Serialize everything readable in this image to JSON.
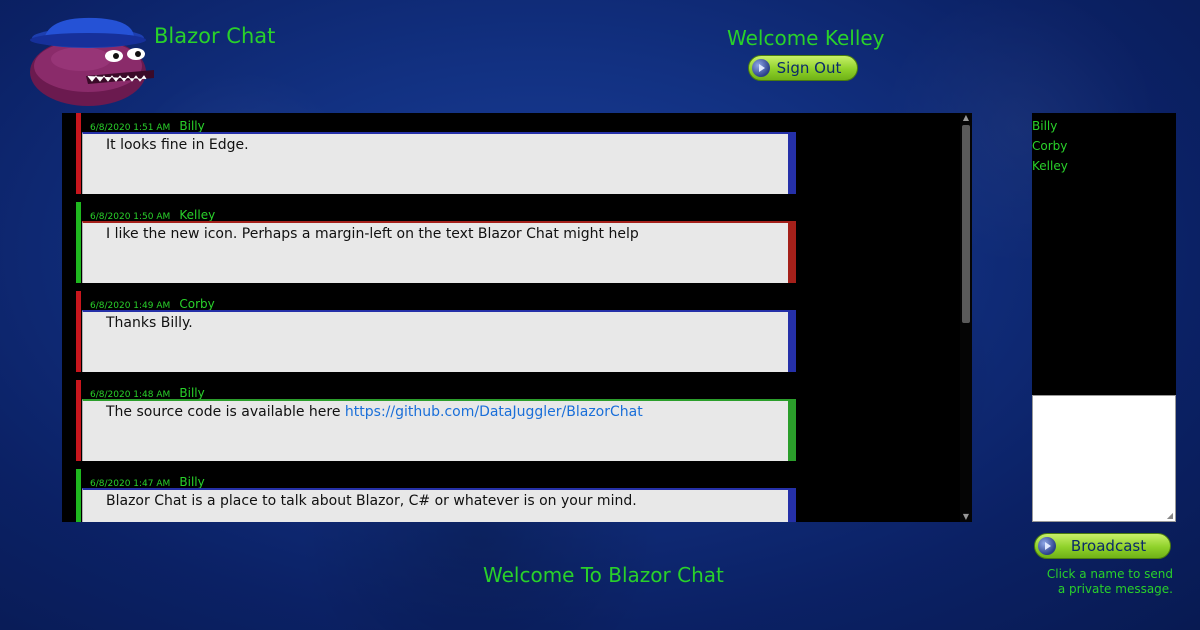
{
  "header": {
    "app_title": "Blazor Chat",
    "welcome_text": "Welcome Kelley",
    "sign_out_label": "Sign Out"
  },
  "colors": {
    "accent_green": "#29d12a",
    "bar_red": "#c8161d",
    "bar_green": "#1fb81f",
    "edge_blue": "#2530a8",
    "edge_red": "#a4201a",
    "edge_green": "#2b9e2b"
  },
  "messages": [
    {
      "time": "6/8/2020 1:51 AM",
      "sender": "Billy",
      "text": "It looks fine in Edge.",
      "link": "",
      "bar_color": "#c8161d",
      "edge_color": "#2530a8"
    },
    {
      "time": "6/8/2020 1:50 AM",
      "sender": "Kelley",
      "text": "I like the new icon. Perhaps a margin-left on the text Blazor Chat might help",
      "link": "",
      "bar_color": "#1fb81f",
      "edge_color": "#a4201a"
    },
    {
      "time": "6/8/2020 1:49 AM",
      "sender": "Corby",
      "text": "Thanks Billy.",
      "link": "",
      "bar_color": "#c8161d",
      "edge_color": "#2530a8"
    },
    {
      "time": "6/8/2020 1:48 AM",
      "sender": "Billy",
      "text": "The source code is available here ",
      "link": "https://github.com/DataJuggler/BlazorChat",
      "bar_color": "#c8161d",
      "edge_color": "#2b9e2b"
    },
    {
      "time": "6/8/2020 1:47 AM",
      "sender": "Billy",
      "text": "Blazor Chat is a place to talk about Blazor, C# or whatever is on your mind.",
      "link": "",
      "bar_color": "#1fb81f",
      "edge_color": "#2530a8"
    }
  ],
  "users": [
    "Billy",
    "Corby",
    "Kelley"
  ],
  "broadcast_label": "Broadcast",
  "footer": {
    "welcome": "Welcome To Blazor Chat",
    "hint_line1": "Click a name to send",
    "hint_line2": "a private message."
  },
  "icons": {
    "logo": "purple-pacman-with-blue-hat",
    "arrow": "blue-arrow-circle-icon",
    "scroll_up": "scroll-up-arrow",
    "scroll_down": "scroll-down-arrow",
    "resize": "resize-grip-icon"
  }
}
